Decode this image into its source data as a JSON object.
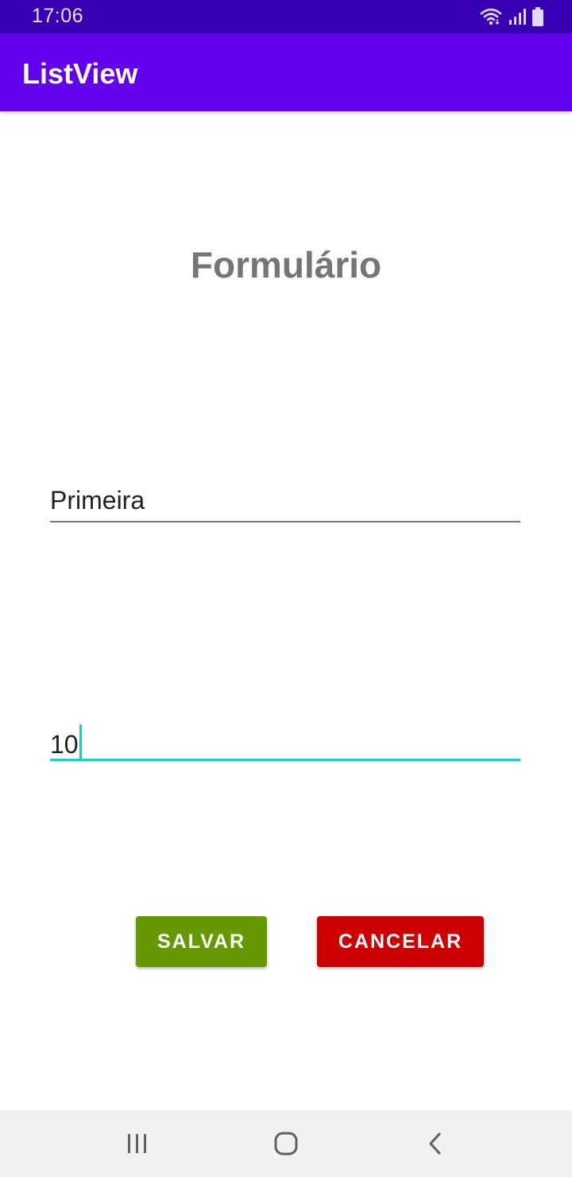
{
  "status_bar": {
    "time": "17:06",
    "icons": [
      "wifi-icon",
      "signal-icon",
      "battery-icon"
    ]
  },
  "app_bar": {
    "title": "ListView",
    "color": "#6200ee"
  },
  "form": {
    "title": "Formulário",
    "name_field": {
      "value": "Primeira"
    },
    "quantity_field": {
      "value": "10",
      "focused": true
    },
    "save_label": "SALVAR",
    "cancel_label": "CANCELAR"
  },
  "colors": {
    "status_bar": "#3700b3",
    "accent": "#1ecbbe",
    "save_button": "#669900",
    "cancel_button": "#cc0000"
  },
  "nav_bar": {
    "icons": [
      "recent-apps-icon",
      "home-icon",
      "back-icon"
    ]
  }
}
